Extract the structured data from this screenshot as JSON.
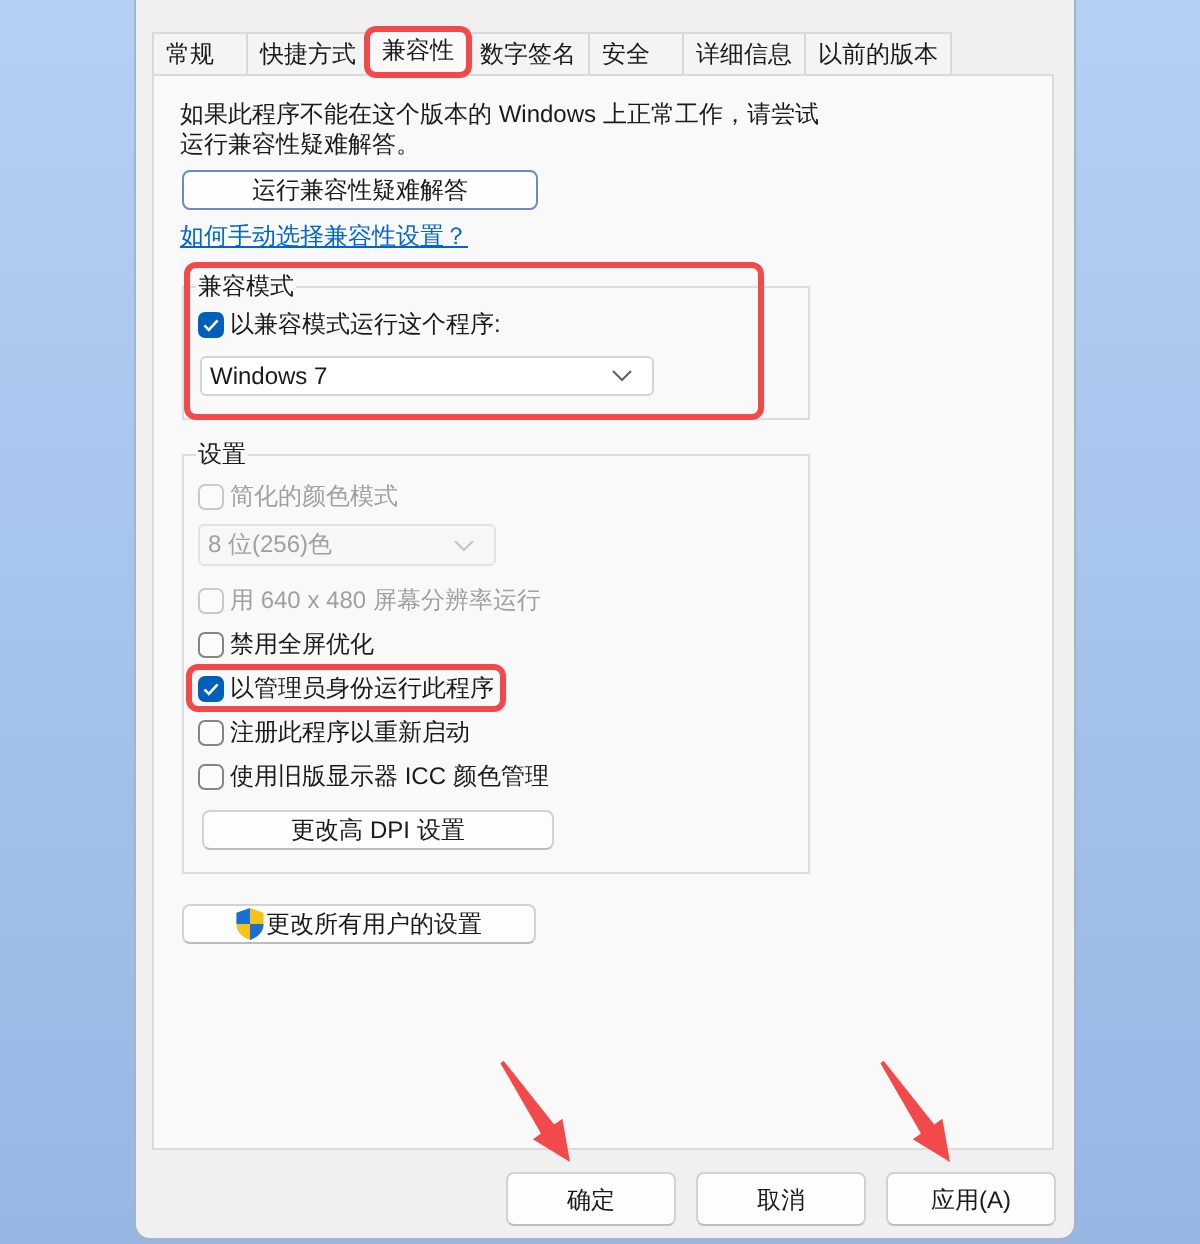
{
  "tabs": [
    {
      "label": "常规",
      "selected": false,
      "highlighted": false
    },
    {
      "label": "快捷方式",
      "selected": false,
      "highlighted": false
    },
    {
      "label": "兼容性",
      "selected": true,
      "highlighted": true
    },
    {
      "label": "数字签名",
      "selected": false,
      "highlighted": false
    },
    {
      "label": "安全",
      "selected": false,
      "highlighted": false
    },
    {
      "label": "详细信息",
      "selected": false,
      "highlighted": false
    },
    {
      "label": "以前的版本",
      "selected": false,
      "highlighted": false
    }
  ],
  "intro": "如果此程序不能在这个版本的 Windows 上正常工作，请尝试运行兼容性疑难解答。",
  "troubleshoot_button": {
    "label": "运行兼容性疑难解答"
  },
  "help_link": "如何手动选择兼容性设置？",
  "compatibility_mode": {
    "title": "兼容模式",
    "highlighted": true,
    "checkbox": {
      "label": "以兼容模式运行这个程序:",
      "checked": true
    },
    "dropdown": {
      "value": "Windows 7"
    }
  },
  "settings": {
    "title": "设置",
    "items": [
      {
        "kind": "checkbox",
        "label": "简化的颜色模式",
        "checked": false,
        "disabled": true,
        "highlighted": false
      },
      {
        "kind": "dropdown",
        "value": "8 位(256)色",
        "disabled": true,
        "highlighted": false
      },
      {
        "kind": "checkbox",
        "label": "用 640 x 480 屏幕分辨率运行",
        "checked": false,
        "disabled": true,
        "highlighted": false
      },
      {
        "kind": "checkbox",
        "label": "禁用全屏优化",
        "checked": false,
        "disabled": false,
        "highlighted": false
      },
      {
        "kind": "checkbox",
        "label": "以管理员身份运行此程序",
        "checked": true,
        "disabled": false,
        "highlighted": true
      },
      {
        "kind": "checkbox",
        "label": "注册此程序以重新启动",
        "checked": false,
        "disabled": false,
        "highlighted": false
      },
      {
        "kind": "checkbox",
        "label": "使用旧版显示器 ICC 颜色管理",
        "checked": false,
        "disabled": false,
        "highlighted": false
      },
      {
        "kind": "button",
        "label": "更改高 DPI 设置",
        "disabled": false,
        "highlighted": false
      }
    ]
  },
  "all_users_button": {
    "label": "更改所有用户的设置"
  },
  "buttons": [
    {
      "label": "确定",
      "arrow": true
    },
    {
      "label": "取消",
      "arrow": false
    },
    {
      "label": "应用(A)",
      "arrow": true
    }
  ]
}
